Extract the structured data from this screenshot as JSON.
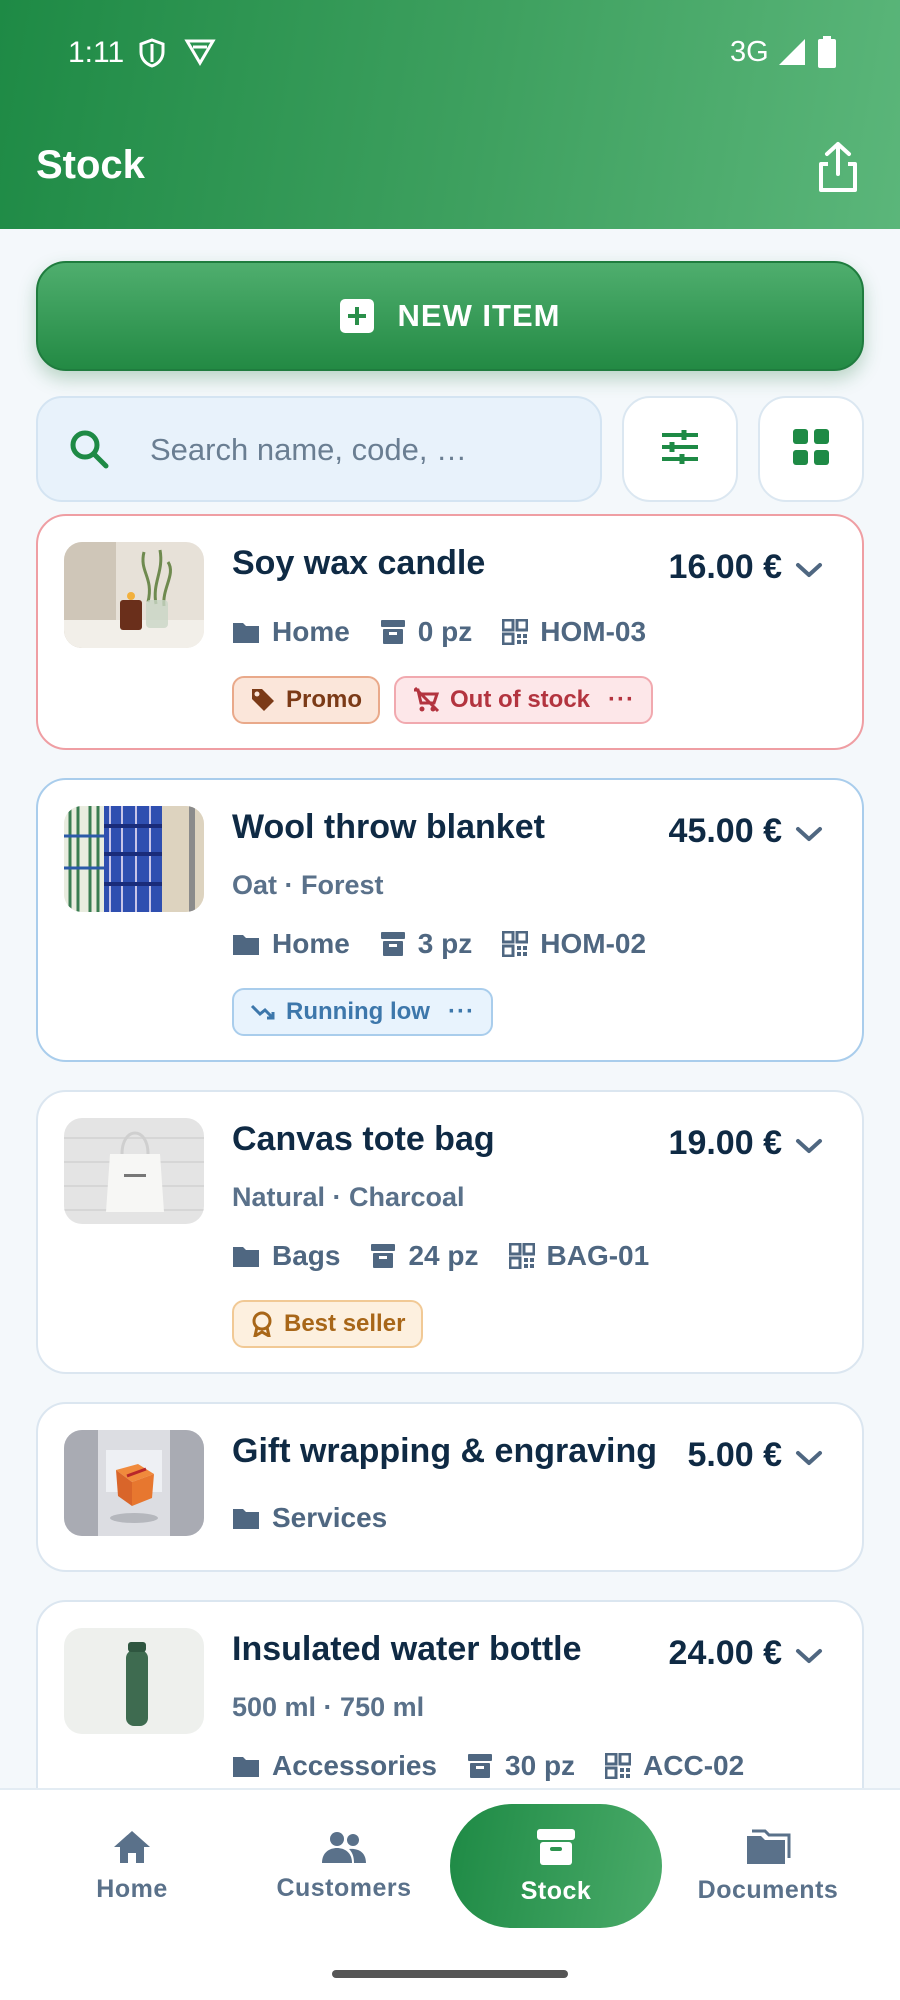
{
  "status_bar": {
    "time": "1:11",
    "network": "3G"
  },
  "header": {
    "title": "Stock"
  },
  "new_item_label": "NEW ITEM",
  "search": {
    "placeholder": "Search name, code, …"
  },
  "items": [
    {
      "name": "Soy wax candle",
      "price": "16.00 €",
      "category": "Home",
      "quantity": "0 pz",
      "code": "HOM-03",
      "tags": [
        "Promo",
        "Out of stock"
      ]
    },
    {
      "name": "Wool throw blanket",
      "price": "45.00 €",
      "variants": "Oat · Forest",
      "category": "Home",
      "quantity": "3 pz",
      "code": "HOM-02",
      "tags": [
        "Running low"
      ]
    },
    {
      "name": "Canvas tote bag",
      "price": "19.00 €",
      "variants": "Natural · Charcoal",
      "category": "Bags",
      "quantity": "24 pz",
      "code": "BAG-01",
      "tags": [
        "Best seller"
      ]
    },
    {
      "name": "Gift wrapping & engraving",
      "price": "5.00 €",
      "category": "Services"
    },
    {
      "name": "Insulated water bottle",
      "price": "24.00 €",
      "variants": "500 ml · 750 ml",
      "category": "Accessories",
      "quantity": "30 pz",
      "code": "ACC-02"
    }
  ],
  "bottom_nav": [
    {
      "label": "Home",
      "icon": "home-icon"
    },
    {
      "label": "Customers",
      "icon": "people-icon"
    },
    {
      "label": "Stock",
      "icon": "archive-icon",
      "active": true
    },
    {
      "label": "Documents",
      "icon": "folder-icon"
    }
  ],
  "colors": {
    "primary": "#1e8a45",
    "out_of_stock": "#b3343f",
    "running_low": "#3d77ab",
    "best_seller": "#a86618"
  }
}
